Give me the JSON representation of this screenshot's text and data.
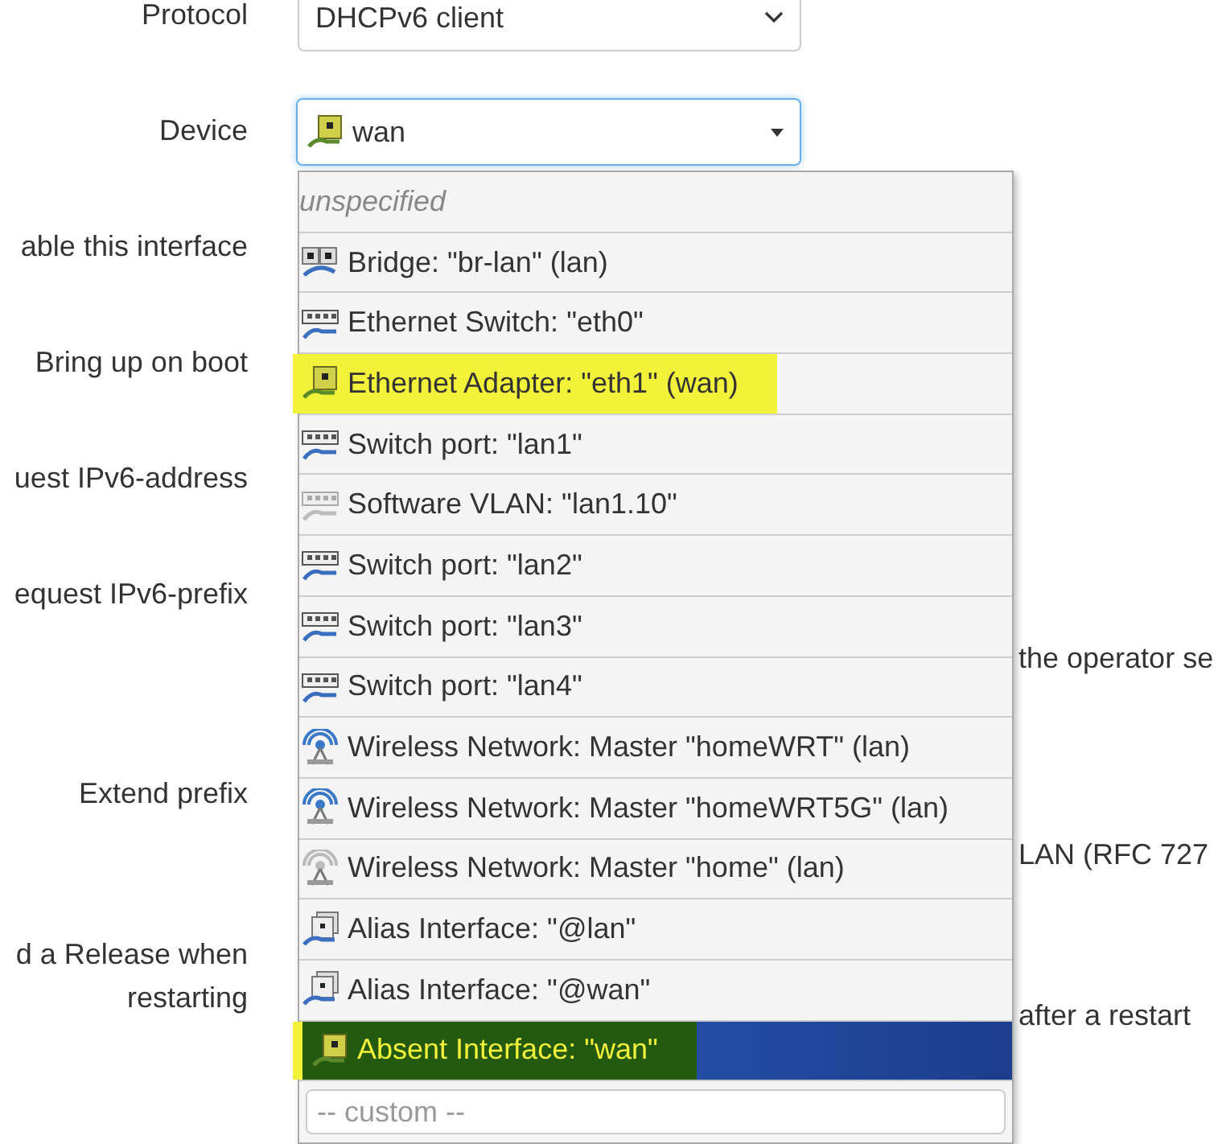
{
  "form": [
    {
      "label": "Protocol",
      "kind": "select",
      "value": "DHCPv6 client"
    },
    {
      "label": "Device",
      "kind": "device_select",
      "value": "wan",
      "focused": true
    },
    {
      "label": "able this interface",
      "kind": "plain"
    },
    {
      "label": "Bring up on boot",
      "kind": "plain"
    },
    {
      "label": "uest IPv6-address",
      "kind": "plain"
    },
    {
      "label": "equest IPv6-prefix",
      "kind": "note",
      "note": "the operator se"
    },
    {
      "label": "Extend prefix",
      "kind": "note",
      "note": "LAN (RFC 727"
    },
    {
      "label": "d a Release when restarting",
      "kind": "note_wrapped",
      "note": "after a restart"
    }
  ],
  "dropdown": {
    "items": [
      {
        "label": "unspecified",
        "kind": "none",
        "selected": false,
        "highlighted": false
      },
      {
        "label": "Bridge: \"br-lan\" (lan)",
        "kind": "bridge",
        "selected": false,
        "highlighted": false
      },
      {
        "label": "Ethernet Switch: \"eth0\"",
        "kind": "switch",
        "selected": false,
        "highlighted": false
      },
      {
        "label": "Ethernet Adapter: \"eth1\" (wan)",
        "kind": "ethernet",
        "selected": false,
        "highlighted": true
      },
      {
        "label": "Switch port: \"lan1\"",
        "kind": "switch",
        "selected": false,
        "highlighted": false
      },
      {
        "label": "Software VLAN: \"lan1.10\"",
        "kind": "vlan",
        "selected": false,
        "highlighted": false
      },
      {
        "label": "Switch port: \"lan2\"",
        "kind": "switch",
        "selected": false,
        "highlighted": false
      },
      {
        "label": "Switch port: \"lan3\"",
        "kind": "switch",
        "selected": false,
        "highlighted": false
      },
      {
        "label": "Switch port: \"lan4\"",
        "kind": "switch",
        "selected": false,
        "highlighted": false
      },
      {
        "label": "Wireless Network: Master \"homeWRT\" (lan)",
        "kind": "wireless",
        "selected": false,
        "highlighted": false
      },
      {
        "label": "Wireless Network: Master \"homeWRT5G\" (lan)",
        "kind": "wireless",
        "selected": false,
        "highlighted": false
      },
      {
        "label": "Wireless Network: Master \"home\" (lan)",
        "kind": "wireless_off",
        "selected": false,
        "highlighted": false
      },
      {
        "label": "Alias Interface: \"@lan\"",
        "kind": "alias",
        "selected": false,
        "highlighted": false
      },
      {
        "label": "Alias Interface: \"@wan\"",
        "kind": "alias",
        "selected": false,
        "highlighted": false
      },
      {
        "label": "Absent Interface: \"wan\"",
        "kind": "ethernet",
        "selected": true,
        "highlighted": true
      }
    ],
    "custom_placeholder": "-- custom --"
  }
}
